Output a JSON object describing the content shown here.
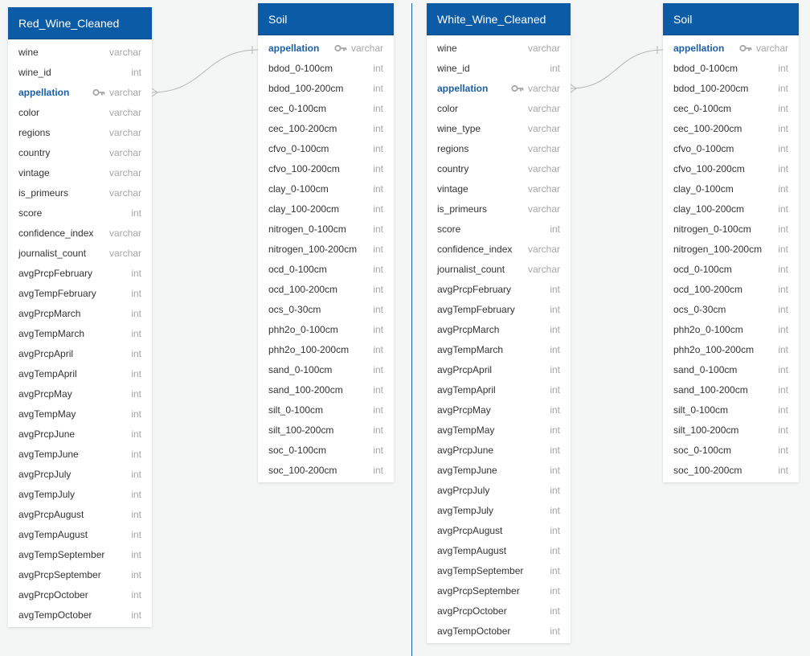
{
  "tables": [
    {
      "id": "red",
      "title": "Red_Wine_Cleaned",
      "columns": [
        {
          "name": "wine",
          "type": "varchar"
        },
        {
          "name": "wine_id",
          "type": "int"
        },
        {
          "name": "appellation",
          "type": "varchar",
          "pk": true
        },
        {
          "name": "color",
          "type": "varchar"
        },
        {
          "name": "regions",
          "type": "varchar"
        },
        {
          "name": "country",
          "type": "varchar"
        },
        {
          "name": "vintage",
          "type": "varchar"
        },
        {
          "name": "is_primeurs",
          "type": "varchar"
        },
        {
          "name": "score",
          "type": "int"
        },
        {
          "name": "confidence_index",
          "type": "varchar"
        },
        {
          "name": "journalist_count",
          "type": "varchar"
        },
        {
          "name": "avgPrcpFebruary",
          "type": "int"
        },
        {
          "name": "avgTempFebruary",
          "type": "int"
        },
        {
          "name": "avgPrcpMarch",
          "type": "int"
        },
        {
          "name": "avgTempMarch",
          "type": "int"
        },
        {
          "name": "avgPrcpApril",
          "type": "int"
        },
        {
          "name": "avgTempApril",
          "type": "int"
        },
        {
          "name": "avgPrcpMay",
          "type": "int"
        },
        {
          "name": "avgTempMay",
          "type": "int"
        },
        {
          "name": "avgPrcpJune",
          "type": "int"
        },
        {
          "name": "avgTempJune",
          "type": "int"
        },
        {
          "name": "avgPrcpJuly",
          "type": "int"
        },
        {
          "name": "avgTempJuly",
          "type": "int"
        },
        {
          "name": "avgPrcpAugust",
          "type": "int"
        },
        {
          "name": "avgTempAugust",
          "type": "int"
        },
        {
          "name": "avgTempSeptember",
          "type": "int"
        },
        {
          "name": "avgPrcpSeptember",
          "type": "int"
        },
        {
          "name": "avgPrcpOctober",
          "type": "int"
        },
        {
          "name": "avgTempOctober",
          "type": "int"
        }
      ]
    },
    {
      "id": "soil-left",
      "title": "Soil",
      "columns": [
        {
          "name": "appellation",
          "type": "varchar",
          "pk": true
        },
        {
          "name": "bdod_0-100cm",
          "type": "int"
        },
        {
          "name": "bdod_100-200cm",
          "type": "int"
        },
        {
          "name": "cec_0-100cm",
          "type": "int"
        },
        {
          "name": "cec_100-200cm",
          "type": "int"
        },
        {
          "name": "cfvo_0-100cm",
          "type": "int"
        },
        {
          "name": "cfvo_100-200cm",
          "type": "int"
        },
        {
          "name": "clay_0-100cm",
          "type": "int"
        },
        {
          "name": "clay_100-200cm",
          "type": "int"
        },
        {
          "name": "nitrogen_0-100cm",
          "type": "int"
        },
        {
          "name": "nitrogen_100-200cm",
          "type": "int"
        },
        {
          "name": "ocd_0-100cm",
          "type": "int"
        },
        {
          "name": "ocd_100-200cm",
          "type": "int"
        },
        {
          "name": "ocs_0-30cm",
          "type": "int"
        },
        {
          "name": "phh2o_0-100cm",
          "type": "int"
        },
        {
          "name": "phh2o_100-200cm",
          "type": "int"
        },
        {
          "name": "sand_0-100cm",
          "type": "int"
        },
        {
          "name": "sand_100-200cm",
          "type": "int"
        },
        {
          "name": "silt_0-100cm",
          "type": "int"
        },
        {
          "name": "silt_100-200cm",
          "type": "int"
        },
        {
          "name": "soc_0-100cm",
          "type": "int"
        },
        {
          "name": "soc_100-200cm",
          "type": "int"
        }
      ]
    },
    {
      "id": "white",
      "title": "White_Wine_Cleaned",
      "columns": [
        {
          "name": "wine",
          "type": "varchar"
        },
        {
          "name": "wine_id",
          "type": "int"
        },
        {
          "name": "appellation",
          "type": "varchar",
          "pk": true
        },
        {
          "name": "color",
          "type": "varchar"
        },
        {
          "name": "wine_type",
          "type": "varchar"
        },
        {
          "name": "regions",
          "type": "varchar"
        },
        {
          "name": "country",
          "type": "varchar"
        },
        {
          "name": "vintage",
          "type": "varchar"
        },
        {
          "name": "is_primeurs",
          "type": "varchar"
        },
        {
          "name": "score",
          "type": "int"
        },
        {
          "name": "confidence_index",
          "type": "varchar"
        },
        {
          "name": "journalist_count",
          "type": "varchar"
        },
        {
          "name": "avgPrcpFebruary",
          "type": "int"
        },
        {
          "name": "avgTempFebruary",
          "type": "int"
        },
        {
          "name": "avgPrcpMarch",
          "type": "int"
        },
        {
          "name": "avgTempMarch",
          "type": "int"
        },
        {
          "name": "avgPrcpApril",
          "type": "int"
        },
        {
          "name": "avgTempApril",
          "type": "int"
        },
        {
          "name": "avgPrcpMay",
          "type": "int"
        },
        {
          "name": "avgTempMay",
          "type": "int"
        },
        {
          "name": "avgPrcpJune",
          "type": "int"
        },
        {
          "name": "avgTempJune",
          "type": "int"
        },
        {
          "name": "avgPrcpJuly",
          "type": "int"
        },
        {
          "name": "avgTempJuly",
          "type": "int"
        },
        {
          "name": "avgPrcpAugust",
          "type": "int"
        },
        {
          "name": "avgTempAugust",
          "type": "int"
        },
        {
          "name": "avgTempSeptember",
          "type": "int"
        },
        {
          "name": "avgPrcpSeptember",
          "type": "int"
        },
        {
          "name": "avgPrcpOctober",
          "type": "int"
        },
        {
          "name": "avgTempOctober",
          "type": "int"
        }
      ]
    },
    {
      "id": "soil-right",
      "title": "Soil",
      "columns": [
        {
          "name": "appellation",
          "type": "varchar",
          "pk": true
        },
        {
          "name": "bdod_0-100cm",
          "type": "int"
        },
        {
          "name": "bdod_100-200cm",
          "type": "int"
        },
        {
          "name": "cec_0-100cm",
          "type": "int"
        },
        {
          "name": "cec_100-200cm",
          "type": "int"
        },
        {
          "name": "cfvo_0-100cm",
          "type": "int"
        },
        {
          "name": "cfvo_100-200cm",
          "type": "int"
        },
        {
          "name": "clay_0-100cm",
          "type": "int"
        },
        {
          "name": "clay_100-200cm",
          "type": "int"
        },
        {
          "name": "nitrogen_0-100cm",
          "type": "int"
        },
        {
          "name": "nitrogen_100-200cm",
          "type": "int"
        },
        {
          "name": "ocd_0-100cm",
          "type": "int"
        },
        {
          "name": "ocd_100-200cm",
          "type": "int"
        },
        {
          "name": "ocs_0-30cm",
          "type": "int"
        },
        {
          "name": "phh2o_0-100cm",
          "type": "int"
        },
        {
          "name": "phh2o_100-200cm",
          "type": "int"
        },
        {
          "name": "sand_0-100cm",
          "type": "int"
        },
        {
          "name": "sand_100-200cm",
          "type": "int"
        },
        {
          "name": "silt_0-100cm",
          "type": "int"
        },
        {
          "name": "silt_100-200cm",
          "type": "int"
        },
        {
          "name": "soc_0-100cm",
          "type": "int"
        },
        {
          "name": "soc_100-200cm",
          "type": "int"
        }
      ]
    }
  ],
  "relations": [
    {
      "from": "red.appellation",
      "to": "soil-left.appellation",
      "from_end": "many",
      "to_end": "one"
    },
    {
      "from": "white.appellation",
      "to": "soil-right.appellation",
      "from_end": "many",
      "to_end": "one"
    }
  ],
  "icons": {
    "primary_key": "key-icon"
  },
  "colors": {
    "header_bg": "#0c5ba7",
    "header_text": "#ffffff",
    "pk_text": "#1b5fa6",
    "type_text": "#a6a6a6",
    "canvas_bg": "#f4f5f5",
    "divider": "#1b5fa6",
    "connector": "#b5b5b5"
  }
}
